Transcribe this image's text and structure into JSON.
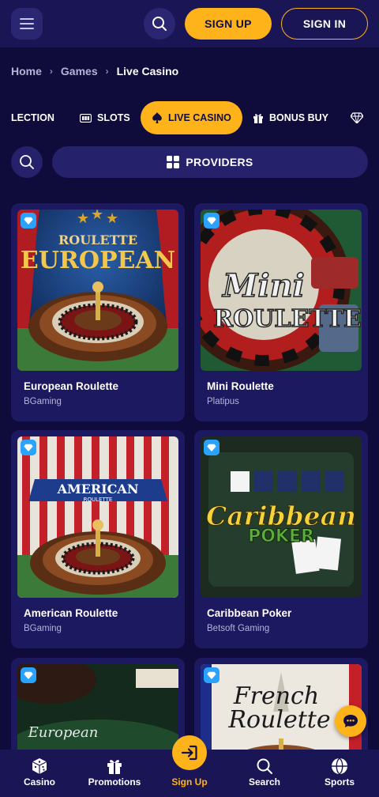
{
  "header": {
    "sign_up_label": "SIGN UP",
    "sign_in_label": "SIGN IN"
  },
  "breadcrumb": {
    "items": [
      "Home",
      "Games",
      "Live Casino"
    ]
  },
  "tabs": {
    "items": [
      {
        "label": "LECTION",
        "icon": "collection-icon"
      },
      {
        "label": "SLOTS",
        "icon": "slots-icon"
      },
      {
        "label": "LIVE CASINO",
        "icon": "spade-icon",
        "active": true
      },
      {
        "label": "BONUS BUY",
        "icon": "gift-icon"
      },
      {
        "label": "",
        "icon": "diamond-icon"
      }
    ]
  },
  "filters": {
    "providers_label": "PROVIDERS"
  },
  "games": [
    {
      "title": "European Roulette",
      "provider": "BGaming",
      "art": "european-roulette"
    },
    {
      "title": "Mini Roulette",
      "provider": "Platipus",
      "art": "mini-roulette"
    },
    {
      "title": "American Roulette",
      "provider": "BGaming",
      "art": "american-roulette"
    },
    {
      "title": "Caribbean Poker",
      "provider": "Betsoft Gaming",
      "art": "caribbean-poker"
    },
    {
      "title": "",
      "provider": "",
      "art": "european-blackjack"
    },
    {
      "title": "",
      "provider": "",
      "art": "french-roulette"
    }
  ],
  "art_text": {
    "european_roulette": {
      "line1": "ROULETTE",
      "line2": "EUROPEAN"
    },
    "mini_roulette": {
      "line1": "Mini",
      "line2": "ROULETTE"
    },
    "american_roulette": {
      "line1": "AMERICAN",
      "line2": "ROULETTE"
    },
    "caribbean_poker": {
      "line1": "Caribbean",
      "line2": "POKER"
    },
    "european_blackjack": {
      "line1": "European"
    },
    "french_roulette": {
      "line1": "French",
      "line2": "Roulette"
    }
  },
  "bottom_nav": {
    "items": [
      {
        "label": "Casino",
        "icon": "dice-icon"
      },
      {
        "label": "Promotions",
        "icon": "gift-icon"
      },
      {
        "label": "Sign Up",
        "icon": "sign-in-arrow-icon",
        "active": true
      },
      {
        "label": "Search",
        "icon": "search-icon"
      },
      {
        "label": "Sports",
        "icon": "ball-icon"
      }
    ]
  },
  "colors": {
    "background": "#0f0b3a",
    "header": "#1a1554",
    "card": "#1d1960",
    "accent": "#ffb31a",
    "badge": "#2aa3ff",
    "muted_text": "#b6b3d8"
  }
}
